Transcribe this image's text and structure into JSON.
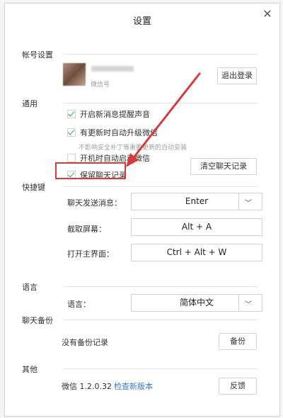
{
  "window": {
    "title": "设置"
  },
  "sections": {
    "account": "帐号设置",
    "general": "通用",
    "shortcuts": "快捷键",
    "language": "语言",
    "backup": "聊天备份",
    "other": "其他"
  },
  "account": {
    "sub_text": "微信号",
    "logout_label": "退出登录"
  },
  "general": {
    "items": [
      {
        "label": "开启新消息提醒声音",
        "checked": true
      },
      {
        "label": "有更新时自动升级微信",
        "checked": true
      },
      {
        "label": "开机时自动启动微信",
        "checked": false
      },
      {
        "label": "保留聊天记录",
        "checked": true
      }
    ],
    "note": "不影响安全补丁等重要更新的自动安装",
    "clear_label": "清空聊天记录"
  },
  "shortcuts": {
    "items": [
      {
        "label": "聊天发送消息：",
        "value": "Enter"
      },
      {
        "label": "截取屏幕：",
        "value": "Alt + A"
      },
      {
        "label": "打开主界面：",
        "value": "Ctrl + Alt + W"
      }
    ]
  },
  "language": {
    "label": "语言：",
    "value": "简体中文"
  },
  "backup": {
    "status": "没有备份记录",
    "button": "备份"
  },
  "other": {
    "version": "微信 1.2.0.32",
    "check_update": "检查新版本",
    "feedback": "反馈"
  },
  "annotation": {
    "color": "#d63a3a"
  }
}
